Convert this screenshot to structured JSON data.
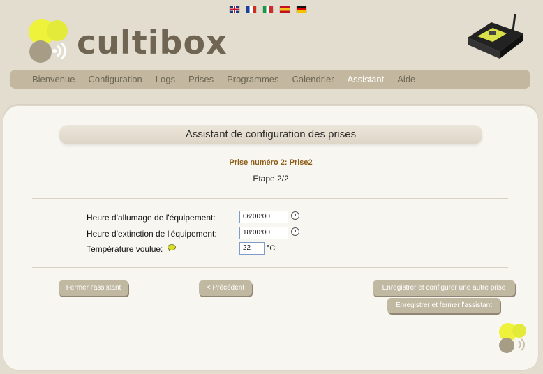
{
  "languages": [
    "en-flag-icon",
    "fr-flag-icon",
    "it-flag-icon",
    "es-flag-icon",
    "de-flag-icon"
  ],
  "brand": {
    "name": "cultibox"
  },
  "nav": {
    "items": [
      {
        "label": "Bienvenue"
      },
      {
        "label": "Configuration"
      },
      {
        "label": "Logs"
      },
      {
        "label": "Prises"
      },
      {
        "label": "Programmes"
      },
      {
        "label": "Calendrier"
      },
      {
        "label": "Assistant",
        "active": true
      },
      {
        "label": "Aide"
      }
    ]
  },
  "wizard": {
    "title": "Assistant de configuration des prises",
    "plug": "Prise numéro 2: Prise2",
    "step": "Etape 2/2",
    "fields": {
      "on_label": "Heure d'allumage de l'équipement:",
      "on_value": "06:00:00",
      "off_label": "Heure d'extinction de l'équipement:",
      "off_value": "18:00:00",
      "temp_label": "Température voulue:",
      "temp_value": "22",
      "temp_unit": "°C"
    },
    "buttons": {
      "close": "Fermer l'assistant",
      "previous": "< Précédent",
      "save_another": "Enregistrer et configurer une autre prise",
      "save_close": "Enregistrer et fermer l'assistant"
    }
  },
  "colors": {
    "navbar": "#c3b89f",
    "active_nav": "#ffffff",
    "button": "#c1b8a2",
    "accent_yellow": "#eef23a",
    "accent_brown": "#8a5b14"
  }
}
